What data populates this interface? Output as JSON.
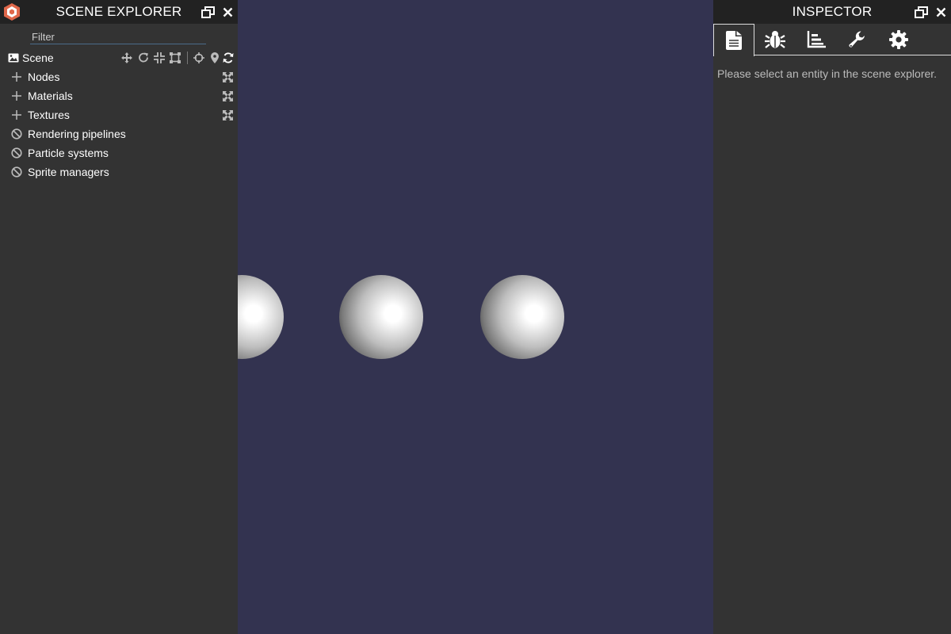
{
  "explorer": {
    "title": "SCENE EXPLORER",
    "filter_placeholder": "Filter",
    "scene_label": "Scene",
    "items": [
      {
        "label": "Nodes",
        "state": "expandable",
        "icon": "plus-icon"
      },
      {
        "label": "Materials",
        "state": "expandable",
        "icon": "plus-icon"
      },
      {
        "label": "Textures",
        "state": "expandable",
        "icon": "plus-icon"
      },
      {
        "label": "Rendering pipelines",
        "state": "empty",
        "icon": "ban-icon"
      },
      {
        "label": "Particle systems",
        "state": "empty",
        "icon": "ban-icon"
      },
      {
        "label": "Sprite managers",
        "state": "empty",
        "icon": "ban-icon"
      }
    ],
    "scene_tools": [
      "move-gizmo-icon",
      "rotate-gizmo-icon",
      "scale-gizmo-icon",
      "bounding-box-gizmo-icon",
      "crosshair-icon",
      "map-marker-icon",
      "refresh-icon"
    ]
  },
  "inspector": {
    "title": "INSPECTOR",
    "tabs": [
      "properties-tab",
      "debug-tab",
      "statistics-tab",
      "tools-tab",
      "settings-tab"
    ],
    "active_tab": "properties-tab",
    "empty_message": "Please select an entity in the scene explorer."
  },
  "colors": {
    "panel_bg": "#333333",
    "header_bg": "#222222",
    "viewport_bg": "#333350",
    "logo_red": "#e0684b",
    "filter_underline": "#4a6b8a"
  }
}
